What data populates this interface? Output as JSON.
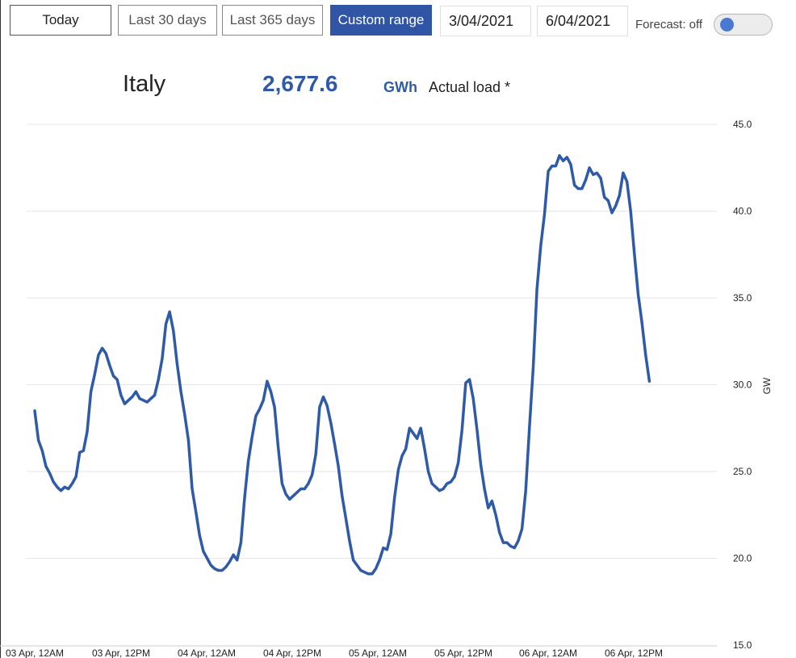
{
  "toolbar": {
    "today_label": "Today",
    "last30_label": "Last 30 days",
    "last365_label": "Last 365 days",
    "custom_label": "Custom range",
    "date_from": "3/04/2021",
    "date_to": "6/04/2021",
    "forecast_label": "Forecast: off",
    "forecast_on": false
  },
  "summary": {
    "country": "Italy",
    "total": "2,677.6",
    "unit": "GWh",
    "metric": "Actual load *"
  },
  "colors": {
    "accent": "#2f55a4",
    "line": "#2f5aa8",
    "grid": "#e6e6e6"
  },
  "chart_data": {
    "type": "line",
    "title": "",
    "xlabel": "",
    "ylabel": "GW",
    "ylim": [
      15,
      45
    ],
    "y_ticks": [
      "15.0",
      "20.0",
      "25.0",
      "30.0",
      "35.0",
      "40.0",
      "45.0"
    ],
    "x_ticks": [
      "03 Apr, 12AM",
      "03 Apr, 12PM",
      "04 Apr, 12AM",
      "04 Apr, 12PM",
      "05 Apr, 12AM",
      "05 Apr, 12PM",
      "06 Apr, 12AM",
      "06 Apr, 12PM"
    ],
    "x_unit": "hours since 03 Apr, 12AM",
    "xlim": [
      0,
      91
    ],
    "grid": true,
    "series": [
      {
        "name": "Actual load",
        "points": [
          [
            0.0,
            28.5
          ],
          [
            0.5,
            26.8
          ],
          [
            1.0,
            26.2
          ],
          [
            1.5,
            25.3
          ],
          [
            2.0,
            24.9
          ],
          [
            2.5,
            24.4
          ],
          [
            3.0,
            24.1
          ],
          [
            3.5,
            23.9
          ],
          [
            4.0,
            24.1
          ],
          [
            4.5,
            24.0
          ],
          [
            5.0,
            24.3
          ],
          [
            5.5,
            24.7
          ],
          [
            6.0,
            26.1
          ],
          [
            6.5,
            26.2
          ],
          [
            7.0,
            27.3
          ],
          [
            7.5,
            29.6
          ],
          [
            8.0,
            30.6
          ],
          [
            8.5,
            31.7
          ],
          [
            9.0,
            32.1
          ],
          [
            9.5,
            31.8
          ],
          [
            10.0,
            31.1
          ],
          [
            10.5,
            30.5
          ],
          [
            11.0,
            30.3
          ],
          [
            11.5,
            29.4
          ],
          [
            12.0,
            28.9
          ],
          [
            12.5,
            29.1
          ],
          [
            13.0,
            29.3
          ],
          [
            13.5,
            29.6
          ],
          [
            14.0,
            29.2
          ],
          [
            14.5,
            29.1
          ],
          [
            15.0,
            29.0
          ],
          [
            15.5,
            29.2
          ],
          [
            16.0,
            29.4
          ],
          [
            16.5,
            30.3
          ],
          [
            17.0,
            31.5
          ],
          [
            17.5,
            33.5
          ],
          [
            18.0,
            34.2
          ],
          [
            18.5,
            33.1
          ],
          [
            19.0,
            31.2
          ],
          [
            19.5,
            29.6
          ],
          [
            20.0,
            28.3
          ],
          [
            20.5,
            26.8
          ],
          [
            21.0,
            24.0
          ],
          [
            21.5,
            22.7
          ],
          [
            22.0,
            21.3
          ],
          [
            22.5,
            20.4
          ],
          [
            23.0,
            20.0
          ],
          [
            23.5,
            19.6
          ],
          [
            24.0,
            19.4
          ],
          [
            24.5,
            19.3
          ],
          [
            25.0,
            19.3
          ],
          [
            25.5,
            19.5
          ],
          [
            26.0,
            19.8
          ],
          [
            26.5,
            20.2
          ],
          [
            27.0,
            19.9
          ],
          [
            27.5,
            20.9
          ],
          [
            28.0,
            23.5
          ],
          [
            28.5,
            25.6
          ],
          [
            29.0,
            27.0
          ],
          [
            29.5,
            28.2
          ],
          [
            30.0,
            28.6
          ],
          [
            30.5,
            29.1
          ],
          [
            31.0,
            30.2
          ],
          [
            31.5,
            29.6
          ],
          [
            32.0,
            28.7
          ],
          [
            32.5,
            26.3
          ],
          [
            33.0,
            24.3
          ],
          [
            33.5,
            23.7
          ],
          [
            34.0,
            23.4
          ],
          [
            34.5,
            23.6
          ],
          [
            35.0,
            23.8
          ],
          [
            35.5,
            24.0
          ],
          [
            36.0,
            24.0
          ],
          [
            36.5,
            24.3
          ],
          [
            37.0,
            24.8
          ],
          [
            37.5,
            26.0
          ],
          [
            38.0,
            28.7
          ],
          [
            38.5,
            29.3
          ],
          [
            39.0,
            28.8
          ],
          [
            39.5,
            27.8
          ],
          [
            40.0,
            26.6
          ],
          [
            40.5,
            25.3
          ],
          [
            41.0,
            23.6
          ],
          [
            41.5,
            22.3
          ],
          [
            42.0,
            21.0
          ],
          [
            42.5,
            19.9
          ],
          [
            43.0,
            19.6
          ],
          [
            43.5,
            19.3
          ],
          [
            44.0,
            19.2
          ],
          [
            44.5,
            19.1
          ],
          [
            45.0,
            19.1
          ],
          [
            45.5,
            19.4
          ],
          [
            46.0,
            19.9
          ],
          [
            46.5,
            20.6
          ],
          [
            47.0,
            20.5
          ],
          [
            47.5,
            21.4
          ],
          [
            48.0,
            23.5
          ],
          [
            48.5,
            25.1
          ],
          [
            49.0,
            25.9
          ],
          [
            49.5,
            26.3
          ],
          [
            50.0,
            27.5
          ],
          [
            50.5,
            27.2
          ],
          [
            51.0,
            26.9
          ],
          [
            51.5,
            27.5
          ],
          [
            52.0,
            26.3
          ],
          [
            52.5,
            25.0
          ],
          [
            53.0,
            24.3
          ],
          [
            53.5,
            24.1
          ],
          [
            54.0,
            23.9
          ],
          [
            54.5,
            24.0
          ],
          [
            55.0,
            24.3
          ],
          [
            55.5,
            24.4
          ],
          [
            56.0,
            24.7
          ],
          [
            56.5,
            25.5
          ],
          [
            57.0,
            27.4
          ],
          [
            57.5,
            30.1
          ],
          [
            58.0,
            30.3
          ],
          [
            58.5,
            29.2
          ],
          [
            59.0,
            27.4
          ],
          [
            59.5,
            25.4
          ],
          [
            60.0,
            24.0
          ],
          [
            60.5,
            22.9
          ],
          [
            61.0,
            23.3
          ],
          [
            61.5,
            22.5
          ],
          [
            62.0,
            21.5
          ],
          [
            62.5,
            20.9
          ],
          [
            63.0,
            20.9
          ],
          [
            63.5,
            20.7
          ],
          [
            64.0,
            20.6
          ],
          [
            64.5,
            21.0
          ],
          [
            65.0,
            21.7
          ],
          [
            65.5,
            23.9
          ],
          [
            66.0,
            27.6
          ],
          [
            66.5,
            31.0
          ],
          [
            67.0,
            35.5
          ],
          [
            67.5,
            38.0
          ],
          [
            68.0,
            39.8
          ],
          [
            68.5,
            42.3
          ],
          [
            69.0,
            42.6
          ],
          [
            69.5,
            42.6
          ],
          [
            70.0,
            43.2
          ],
          [
            70.5,
            42.9
          ],
          [
            71.0,
            43.1
          ],
          [
            71.5,
            42.7
          ],
          [
            72.0,
            41.5
          ],
          [
            72.5,
            41.3
          ],
          [
            73.0,
            41.3
          ],
          [
            73.5,
            41.8
          ],
          [
            74.0,
            42.5
          ],
          [
            74.5,
            42.1
          ],
          [
            75.0,
            42.2
          ],
          [
            75.5,
            41.9
          ],
          [
            76.0,
            40.8
          ],
          [
            76.5,
            40.6
          ],
          [
            77.0,
            39.9
          ],
          [
            77.5,
            40.3
          ],
          [
            78.0,
            40.9
          ],
          [
            78.5,
            42.2
          ],
          [
            79.0,
            41.7
          ],
          [
            79.5,
            40.0
          ],
          [
            80.0,
            37.5
          ],
          [
            80.5,
            35.2
          ],
          [
            81.0,
            33.6
          ],
          [
            81.5,
            31.7
          ],
          [
            82.0,
            30.2
          ]
        ]
      }
    ]
  }
}
